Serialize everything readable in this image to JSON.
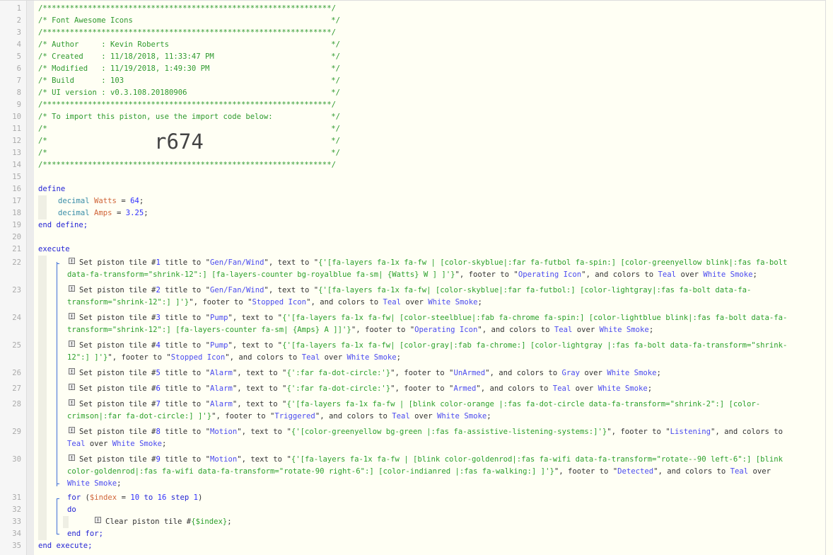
{
  "lines": [
    {
      "n": "1",
      "segs": [
        [
          "c",
          "/****************************************************************/"
        ]
      ]
    },
    {
      "n": "2",
      "segs": [
        [
          "c",
          "/* Font Awesome Icons"
        ],
        [
          "end",
          "*/"
        ]
      ]
    },
    {
      "n": "3",
      "segs": [
        [
          "c",
          "/****************************************************************/"
        ]
      ]
    },
    {
      "n": "4",
      "segs": [
        [
          "c",
          "/* Author     : Kevin Roberts"
        ],
        [
          "end",
          "*/"
        ]
      ]
    },
    {
      "n": "5",
      "segs": [
        [
          "c",
          "/* Created    : 11/18/2018, 11:33:47 PM"
        ],
        [
          "end",
          "*/"
        ]
      ]
    },
    {
      "n": "6",
      "segs": [
        [
          "c",
          "/* Modified   : 11/19/2018, 1:49:30 PM"
        ],
        [
          "end",
          "*/"
        ]
      ]
    },
    {
      "n": "7",
      "segs": [
        [
          "c",
          "/* Build      : 103"
        ],
        [
          "end",
          "*/"
        ]
      ]
    },
    {
      "n": "8",
      "segs": [
        [
          "c",
          "/* UI version : v0.3.108.20180906"
        ],
        [
          "end",
          "*/"
        ]
      ]
    },
    {
      "n": "9",
      "segs": [
        [
          "c",
          "/****************************************************************/"
        ]
      ]
    },
    {
      "n": "10",
      "segs": [
        [
          "c",
          "/* To import this piston, use the import code below:"
        ],
        [
          "end",
          "*/"
        ]
      ]
    },
    {
      "n": "11",
      "segs": [
        [
          "c",
          "/*"
        ],
        [
          "end",
          "*/"
        ]
      ]
    },
    {
      "n": "12",
      "segs": [
        [
          "c",
          "/*"
        ],
        [
          "big",
          "r674"
        ],
        [
          "end",
          "*/"
        ]
      ]
    },
    {
      "n": "13",
      "segs": [
        [
          "c",
          "/*"
        ],
        [
          "end",
          "*/"
        ]
      ]
    },
    {
      "n": "14",
      "segs": [
        [
          "c",
          "/****************************************************************/"
        ]
      ]
    },
    {
      "n": "15",
      "segs": []
    },
    {
      "n": "16",
      "segs": [
        [
          "k",
          "define"
        ]
      ]
    },
    {
      "n": "17",
      "segs": [
        [
          "t",
          "decimal"
        ],
        [
          "p",
          " "
        ],
        [
          "v",
          "Watts"
        ],
        [
          "p",
          " = "
        ],
        [
          "n",
          "64"
        ],
        [
          "p",
          ";"
        ]
      ]
    },
    {
      "n": "18",
      "segs": [
        [
          "t",
          "decimal"
        ],
        [
          "p",
          " "
        ],
        [
          "v",
          "Amps"
        ],
        [
          "p",
          " = "
        ],
        [
          "n",
          "3.25"
        ],
        [
          "p",
          ";"
        ]
      ]
    },
    {
      "n": "19",
      "segs": [
        [
          "k",
          "end define;"
        ]
      ]
    },
    {
      "n": "20",
      "segs": []
    },
    {
      "n": "21",
      "segs": [
        [
          "k",
          "execute"
        ]
      ]
    },
    {
      "n": "22",
      "segs": [
        [
          "p",
          "Set piston tile #"
        ],
        [
          "n",
          "1"
        ],
        [
          "p",
          " title to \""
        ],
        [
          "s",
          "Gen/Fan/Wind"
        ],
        [
          "p",
          "\", text to \""
        ],
        [
          "g",
          "{'[fa-layers fa-1x fa-fw | [color-skyblue|:far fa-futbol fa-spin:] [color-greenyellow blink|:fas fa-bolt data-fa-transform=\"shrink-12\":] [fa-layers-counter bg-royalblue fa-sm| {Watts} W ] ]'}"
        ],
        [
          "p",
          "\", footer to \""
        ],
        [
          "s",
          "Operating Icon"
        ],
        [
          "p",
          "\", and colors to "
        ],
        [
          "s",
          "Teal"
        ],
        [
          "p",
          " over "
        ],
        [
          "s",
          "White Smoke"
        ],
        [
          "p",
          ";"
        ]
      ]
    },
    {
      "n": "23",
      "segs": [
        [
          "p",
          "Set piston tile #"
        ],
        [
          "n",
          "2"
        ],
        [
          "p",
          " title to \""
        ],
        [
          "s",
          "Gen/Fan/Wind"
        ],
        [
          "p",
          "\", text to \""
        ],
        [
          "g",
          "{'[fa-layers fa-1x fa-fw| [color-skyblue|:far fa-futbol:] [color-lightgray|:fas fa-bolt data-fa-transform=\"shrink-12\":] ]'}"
        ],
        [
          "p",
          "\", footer to \""
        ],
        [
          "s",
          "Stopped Icon"
        ],
        [
          "p",
          "\", and colors to "
        ],
        [
          "s",
          "Teal"
        ],
        [
          "p",
          " over "
        ],
        [
          "s",
          "White Smoke"
        ],
        [
          "p",
          ";"
        ]
      ]
    },
    {
      "n": "24",
      "segs": [
        [
          "p",
          "Set piston tile #"
        ],
        [
          "n",
          "3"
        ],
        [
          "p",
          " title to \""
        ],
        [
          "s",
          "Pump"
        ],
        [
          "p",
          "\", text to \""
        ],
        [
          "g",
          "{'[fa-layers fa-1x fa-fw| [color-steelblue|:fab fa-chrome fa-spin:] [color-lightblue blink|:fas fa-bolt data-fa-transform=\"shrink-12\":] [fa-layers-counter fa-sm| {Amps} A ]]'}"
        ],
        [
          "p",
          "\", footer to \""
        ],
        [
          "s",
          "Operating Icon"
        ],
        [
          "p",
          "\", and colors to "
        ],
        [
          "s",
          "Teal"
        ],
        [
          "p",
          " over "
        ],
        [
          "s",
          "White Smoke"
        ],
        [
          "p",
          ";"
        ]
      ]
    },
    {
      "n": "25",
      "segs": [
        [
          "p",
          "Set piston tile #"
        ],
        [
          "n",
          "4"
        ],
        [
          "p",
          " title to \""
        ],
        [
          "s",
          "Pump"
        ],
        [
          "p",
          "\", text to \""
        ],
        [
          "g",
          "{'[fa-layers fa-1x fa-fw| [color-gray|:fab fa-chrome:] [color-lightgray |:fas fa-bolt data-fa-transform=\"shrink-12\":] ]'}"
        ],
        [
          "p",
          "\", footer to \""
        ],
        [
          "s",
          "Stopped Icon"
        ],
        [
          "p",
          "\", and colors to "
        ],
        [
          "s",
          "Teal"
        ],
        [
          "p",
          " over "
        ],
        [
          "s",
          "White Smoke"
        ],
        [
          "p",
          ";"
        ]
      ]
    },
    {
      "n": "26",
      "segs": [
        [
          "p",
          "Set piston tile #"
        ],
        [
          "n",
          "5"
        ],
        [
          "p",
          " title to \""
        ],
        [
          "s",
          "Alarm"
        ],
        [
          "p",
          "\", text to \""
        ],
        [
          "g",
          "{':far fa-dot-circle:'}"
        ],
        [
          "p",
          "\", footer to \""
        ],
        [
          "s",
          "UnArmed"
        ],
        [
          "p",
          "\", and colors to "
        ],
        [
          "s",
          "Gray"
        ],
        [
          "p",
          " over "
        ],
        [
          "s",
          "White Smoke"
        ],
        [
          "p",
          ";"
        ]
      ]
    },
    {
      "n": "27",
      "segs": [
        [
          "p",
          "Set piston tile #"
        ],
        [
          "n",
          "6"
        ],
        [
          "p",
          " title to \""
        ],
        [
          "s",
          "Alarm"
        ],
        [
          "p",
          "\", text to \""
        ],
        [
          "g",
          "{':far fa-dot-circle:'}"
        ],
        [
          "p",
          "\", footer to \""
        ],
        [
          "s",
          "Armed"
        ],
        [
          "p",
          "\", and colors to "
        ],
        [
          "s",
          "Teal"
        ],
        [
          "p",
          " over "
        ],
        [
          "s",
          "White Smoke"
        ],
        [
          "p",
          ";"
        ]
      ]
    },
    {
      "n": "28",
      "segs": [
        [
          "p",
          "Set piston tile #"
        ],
        [
          "n",
          "7"
        ],
        [
          "p",
          " title to \""
        ],
        [
          "s",
          "Alarm"
        ],
        [
          "p",
          "\", text to \""
        ],
        [
          "g",
          "{'[fa-layers fa-1x fa-fw | [blink color-orange |:fas fa-dot-circle data-fa-transform=\"shrink-2\":] [color-crimson|:far fa-dot-circle:] ]'}"
        ],
        [
          "p",
          "\", footer to \""
        ],
        [
          "s",
          "Triggered"
        ],
        [
          "p",
          "\", and colors to "
        ],
        [
          "s",
          "Teal"
        ],
        [
          "p",
          " over "
        ],
        [
          "s",
          "White Smoke"
        ],
        [
          "p",
          ";"
        ]
      ]
    },
    {
      "n": "29",
      "segs": [
        [
          "p",
          "Set piston tile #"
        ],
        [
          "n",
          "8"
        ],
        [
          "p",
          " title to \""
        ],
        [
          "s",
          "Motion"
        ],
        [
          "p",
          "\", text to \""
        ],
        [
          "g",
          "{'[color-greenyellow bg-green |:fas fa-assistive-listening-systems:]'}"
        ],
        [
          "p",
          "\", footer to \""
        ],
        [
          "s",
          "Listening"
        ],
        [
          "p",
          "\", and colors to "
        ],
        [
          "s",
          "Teal"
        ],
        [
          "p",
          " over "
        ],
        [
          "s",
          "White Smoke"
        ],
        [
          "p",
          ";"
        ]
      ]
    },
    {
      "n": "30",
      "segs": [
        [
          "p",
          "Set piston tile #"
        ],
        [
          "n",
          "9"
        ],
        [
          "p",
          " title to \""
        ],
        [
          "s",
          "Motion"
        ],
        [
          "p",
          "\", text to \""
        ],
        [
          "g",
          "{'[fa-layers fa-1x fa-fw | [blink color-goldenrod|:fas fa-wifi data-fa-transform=\"rotate--90 left-6\":] [blink color-goldenrod|:fas fa-wifi data-fa-transform=\"rotate-90 right-6\":] [color-indianred |:fas fa-walking:] ]'}"
        ],
        [
          "p",
          "\", footer to \""
        ],
        [
          "s",
          "Detected"
        ],
        [
          "p",
          "\", and colors to "
        ],
        [
          "s",
          "Teal"
        ],
        [
          "p",
          " over "
        ],
        [
          "s",
          "White Smoke"
        ],
        [
          "p",
          ";"
        ]
      ]
    },
    {
      "n": "31",
      "segs": [
        [
          "k",
          "for"
        ],
        [
          "p",
          " ("
        ],
        [
          "v",
          "$index"
        ],
        [
          "p",
          " = "
        ],
        [
          "n",
          "10"
        ],
        [
          "k",
          " to "
        ],
        [
          "n",
          "16"
        ],
        [
          "k",
          " step "
        ],
        [
          "n",
          "1"
        ],
        [
          "p",
          ")"
        ]
      ]
    },
    {
      "n": "32",
      "segs": [
        [
          "k",
          "do"
        ]
      ]
    },
    {
      "n": "33",
      "segs": [
        [
          "p",
          "Clear piston tile #"
        ],
        [
          "g",
          "{$index}"
        ],
        [
          "p",
          ";"
        ]
      ]
    },
    {
      "n": "34",
      "segs": [
        [
          "k",
          "end for;"
        ]
      ]
    },
    {
      "n": "35",
      "segs": [
        [
          "k",
          "end execute;"
        ]
      ]
    }
  ]
}
